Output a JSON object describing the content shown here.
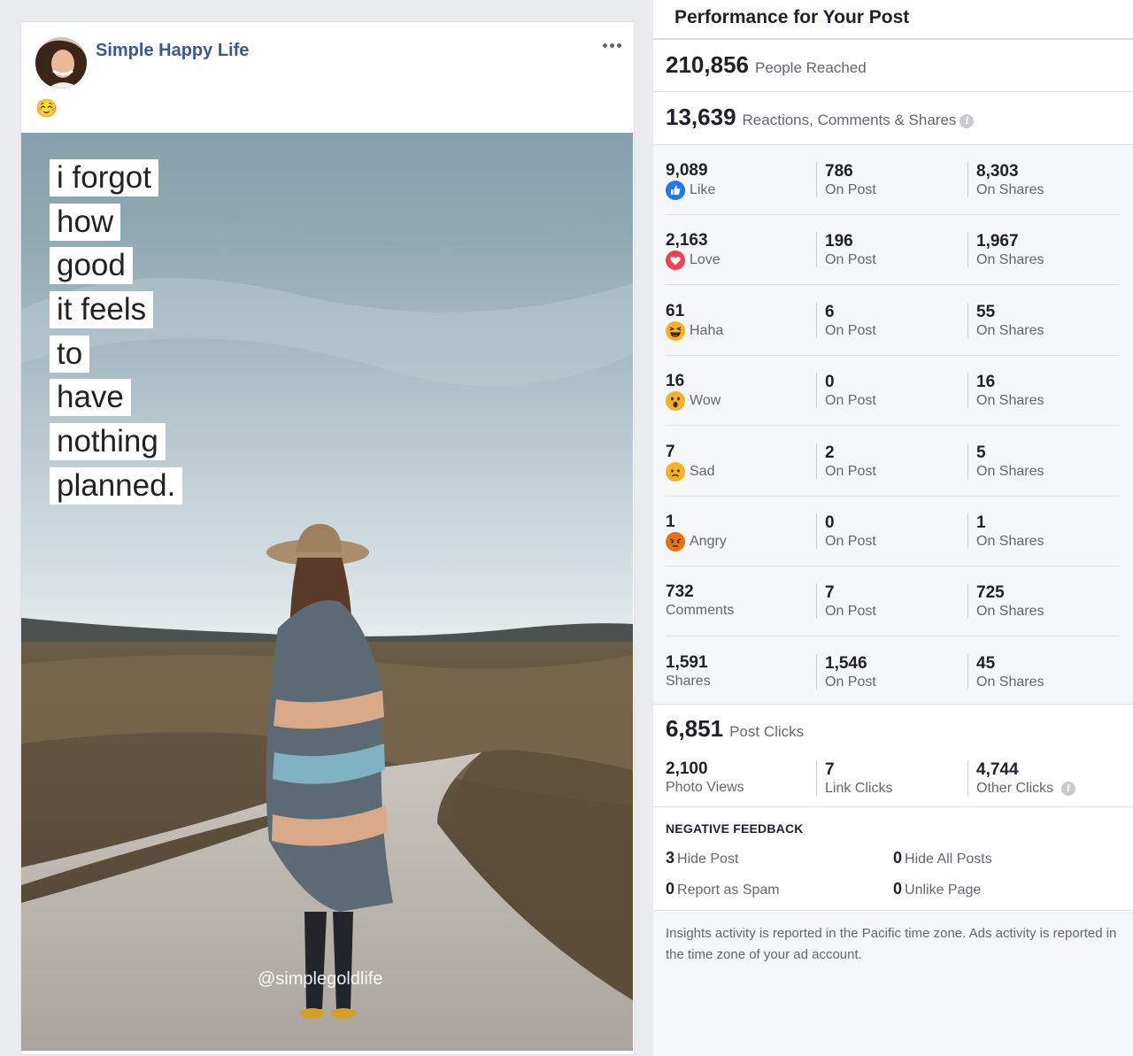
{
  "post": {
    "page_name": "Simple Happy Life",
    "caption_emoji": "☺️",
    "more_icon": "more-horizontal-icon",
    "image": {
      "quote_lines": [
        "i forgot",
        "how",
        "good",
        "it feels",
        "to",
        "have",
        "nothing",
        "planned."
      ],
      "watermark": "@simplegoldlife"
    }
  },
  "insights": {
    "title": "Performance for Your Post",
    "people_reached": {
      "value": "210,856",
      "label": "People Reached"
    },
    "engagement": {
      "value": "13,639",
      "label": "Reactions, Comments & Shares"
    },
    "rows": [
      {
        "icon": "like-icon",
        "color": "#2078f4",
        "total": "9,089",
        "label": "Like",
        "on_post": "786",
        "on_post_label": "On Post",
        "on_shares": "8,303",
        "on_shares_label": "On Shares"
      },
      {
        "icon": "love-icon",
        "color": "#f33e58",
        "total": "2,163",
        "label": "Love",
        "on_post": "196",
        "on_post_label": "On Post",
        "on_shares": "1,967",
        "on_shares_label": "On Shares"
      },
      {
        "icon": "haha-icon",
        "color": "#f7b125",
        "total": "61",
        "label": "Haha",
        "on_post": "6",
        "on_post_label": "On Post",
        "on_shares": "55",
        "on_shares_label": "On Shares"
      },
      {
        "icon": "wow-icon",
        "color": "#f7b125",
        "total": "16",
        "label": "Wow",
        "on_post": "0",
        "on_post_label": "On Post",
        "on_shares": "16",
        "on_shares_label": "On Shares"
      },
      {
        "icon": "sad-icon",
        "color": "#f7b125",
        "total": "7",
        "label": "Sad",
        "on_post": "2",
        "on_post_label": "On Post",
        "on_shares": "5",
        "on_shares_label": "On Shares"
      },
      {
        "icon": "angry-icon",
        "color": "#e9710f",
        "total": "1",
        "label": "Angry",
        "on_post": "0",
        "on_post_label": "On Post",
        "on_shares": "1",
        "on_shares_label": "On Shares"
      },
      {
        "icon": "",
        "color": "",
        "total": "732",
        "label": "Comments",
        "on_post": "7",
        "on_post_label": "On Post",
        "on_shares": "725",
        "on_shares_label": "On Shares"
      },
      {
        "icon": "",
        "color": "",
        "total": "1,591",
        "label": "Shares",
        "on_post": "1,546",
        "on_post_label": "On Post",
        "on_shares": "45",
        "on_shares_label": "On Shares"
      }
    ],
    "post_clicks": {
      "value": "6,851",
      "label": "Post Clicks"
    },
    "clicks": [
      {
        "value": "2,100",
        "label": "Photo Views"
      },
      {
        "value": "7",
        "label": "Link Clicks"
      },
      {
        "value": "4,744",
        "label": "Other Clicks"
      }
    ],
    "negative_feedback": {
      "title": "NEGATIVE FEEDBACK",
      "items": [
        {
          "value": "3",
          "label": "Hide Post"
        },
        {
          "value": "0",
          "label": "Hide All Posts"
        },
        {
          "value": "0",
          "label": "Report as Spam"
        },
        {
          "value": "0",
          "label": "Unlike Page"
        }
      ]
    },
    "footer_note": "Insights activity is reported in the Pacific time zone. Ads activity is reported in the time zone of your ad account."
  }
}
